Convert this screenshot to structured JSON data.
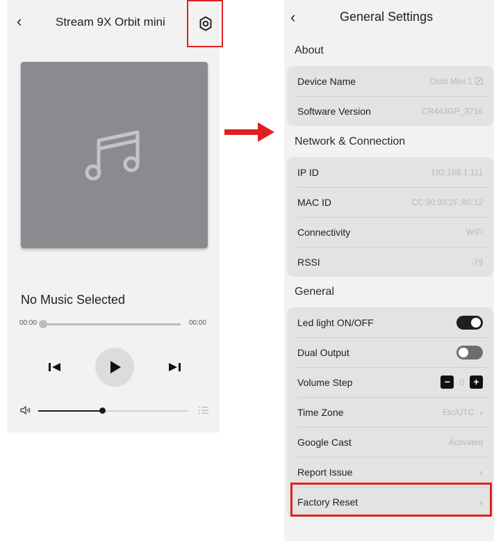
{
  "player": {
    "back_icon": "chevron-left-icon",
    "title": "Stream 9X Orbit mini",
    "settings_icon": "gear-icon",
    "artwork_icon": "music-note-icon",
    "track_title": "No Music Selected",
    "time_elapsed": "00:00",
    "time_total": "00:00",
    "progress": 0,
    "volume": 0.43
  },
  "settings": {
    "title": "General Settings",
    "sections": [
      {
        "title": "About",
        "rows": [
          {
            "label": "Device Name",
            "value": "Orbit Mini 1"
          },
          {
            "label": "Software Version",
            "value": "CR443GP_3716"
          }
        ]
      },
      {
        "title": "Network & Connection",
        "rows": [
          {
            "label": "IP ID",
            "value": "192.168.1.111"
          },
          {
            "label": "MAC ID",
            "value": "CC:90:93:2F:A0:12"
          },
          {
            "label": "Connectivity",
            "value": "WiFi"
          },
          {
            "label": "RSSI",
            "value": "-79"
          }
        ]
      },
      {
        "title": "General",
        "rows": [
          {
            "label": "Led light ON/OFF",
            "toggle": true
          },
          {
            "label": "Dual Output",
            "toggle": false
          },
          {
            "label": "Volume Step",
            "stepper_value": "0"
          },
          {
            "label": "Time Zone",
            "value": "Etc/UTC"
          },
          {
            "label": "Google Cast",
            "value": "Activated"
          },
          {
            "label": "Report Issue"
          },
          {
            "label": "Factory Reset"
          }
        ]
      }
    ]
  },
  "colors": {
    "highlight": "#e02020",
    "panel_bg": "#f2f2f2",
    "group_bg": "#e3e3e3",
    "artwork_bg": "#8a8b8e"
  }
}
